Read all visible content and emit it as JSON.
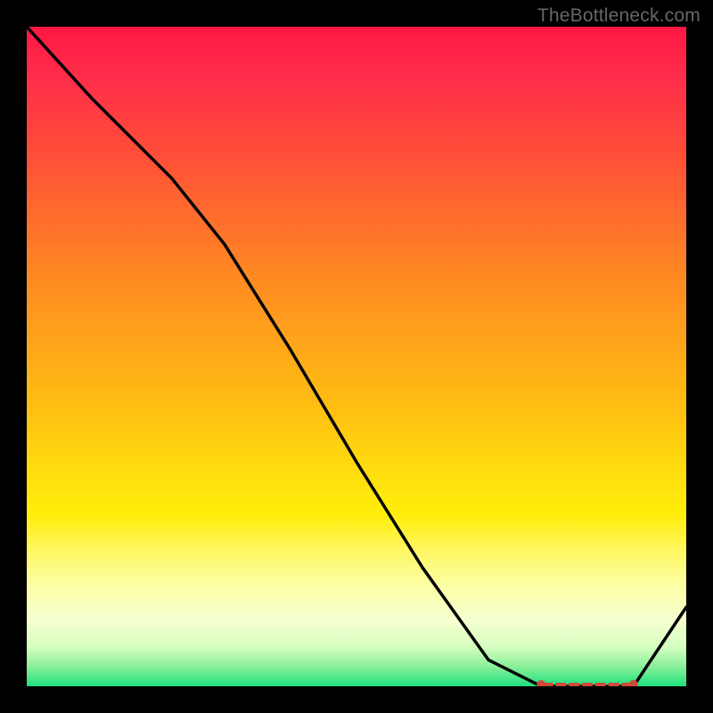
{
  "attribution": "TheBottleneck.com",
  "chart_data": {
    "type": "line",
    "title": "",
    "xlabel": "",
    "ylabel": "",
    "xlim": [
      0,
      100
    ],
    "ylim": [
      0,
      100
    ],
    "series": [
      {
        "name": "curve",
        "x": [
          0,
          10,
          22,
          30,
          40,
          50,
          60,
          70,
          78,
          82,
          86,
          89,
          92,
          100
        ],
        "values": [
          100,
          89,
          77,
          67,
          51,
          34,
          18,
          4,
          0,
          0,
          0,
          0,
          0,
          12
        ]
      }
    ],
    "markers": {
      "name": "bottom-highlight",
      "color": "#d04a3a",
      "x": [
        78,
        80,
        82,
        84,
        86,
        88,
        90,
        92
      ],
      "values": [
        0,
        0,
        0,
        0,
        0,
        0,
        0,
        0
      ]
    }
  }
}
